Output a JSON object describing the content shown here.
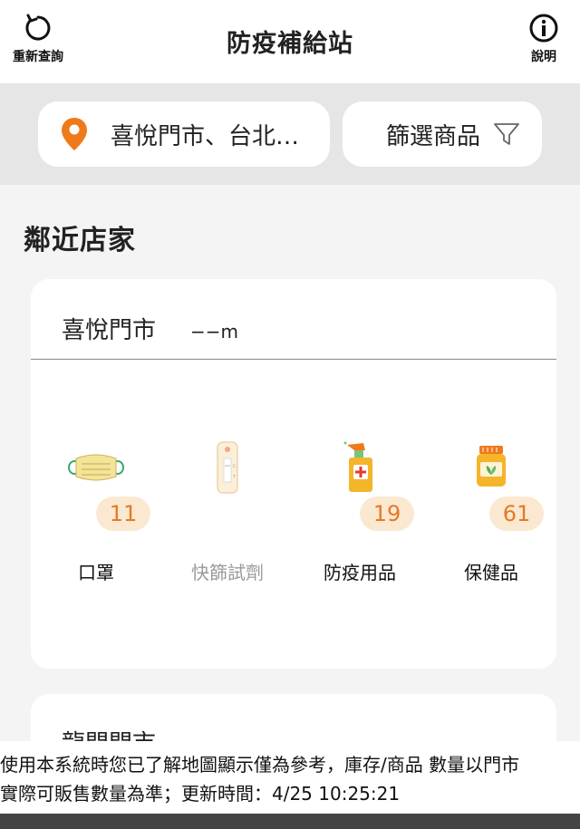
{
  "header": {
    "refresh_label": "重新查詢",
    "title": "防疫補給站",
    "help_label": "說明"
  },
  "search": {
    "location": "喜悅門市、台北…",
    "filter_label": "篩選商品",
    "accent": "#f07a1a"
  },
  "section_title": "鄰近店家",
  "stores": [
    {
      "name": "喜悅門市",
      "distance": "−−m",
      "products": [
        {
          "label": "口罩",
          "count": "11",
          "icon": "mask-icon",
          "available": true
        },
        {
          "label": "快篩試劑",
          "count": "",
          "icon": "test-kit-icon",
          "available": false
        },
        {
          "label": "防疫用品",
          "count": "19",
          "icon": "sanitizer-icon",
          "available": true
        },
        {
          "label": "保健品",
          "count": "61",
          "icon": "supplement-icon",
          "available": true
        }
      ]
    },
    {
      "name": "龍門門市"
    }
  ],
  "notice": {
    "line1": "使用本系統時您已了解地圖顯示僅為參考，庫存/商品 數量以門市",
    "line2": "實際可販售數量為準；更新時間：4/25 10:25:21"
  },
  "colors": {
    "badge_bg": "#fbe8d0",
    "badge_text": "#e37a27"
  }
}
